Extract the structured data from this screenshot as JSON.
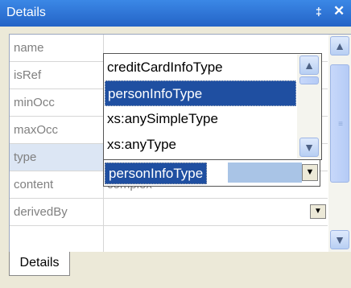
{
  "window": {
    "title": "Details",
    "pin_glyph": "‡",
    "close_glyph": "✕"
  },
  "properties": [
    {
      "name": "name",
      "value": ""
    },
    {
      "name": "isRef",
      "value": ""
    },
    {
      "name": "minOcc",
      "value": ""
    },
    {
      "name": "maxOcc",
      "value": ""
    },
    {
      "name": "type",
      "value": ""
    },
    {
      "name": "content",
      "value": "complex"
    },
    {
      "name": "derivedBy",
      "value": ""
    },
    {
      "name": "",
      "value": ""
    }
  ],
  "selected_property": "type",
  "type_dropdown": {
    "current_value": "personInfoType",
    "options": [
      "creditCardInfoType",
      "personInfoType",
      "xs:anySimpleType",
      "xs:anyType"
    ],
    "highlighted": "personInfoType"
  },
  "tabs": [
    {
      "label": "Details"
    }
  ],
  "colors": {
    "titlebar": "#2a6fd8",
    "selection": "#1f4fa1",
    "label_text": "#808080"
  }
}
